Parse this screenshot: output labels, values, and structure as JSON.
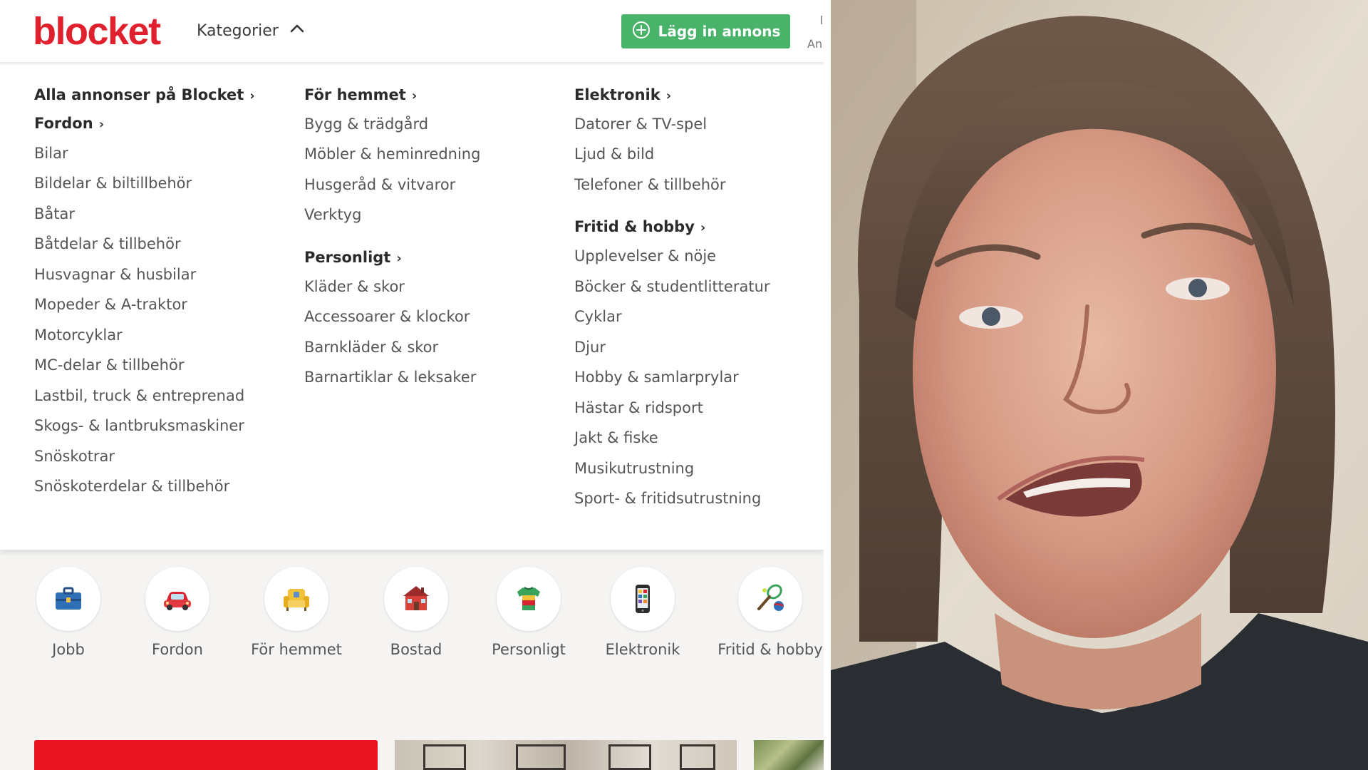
{
  "header": {
    "logo": "blocket",
    "categories_label": "Kategorier",
    "post_ad_label": "Lägg in annons",
    "edge_label": "An"
  },
  "menu": {
    "col1": {
      "heading_all": "Alla annonser på Blocket",
      "heading": "Fordon",
      "items": [
        "Bilar",
        "Bildelar & biltillbehör",
        "Båtar",
        "Båtdelar & tillbehör",
        "Husvagnar & husbilar",
        "Mopeder & A-traktor",
        "Motorcyklar",
        "MC-delar & tillbehör",
        "Lastbil, truck & entreprenad",
        "Skogs- & lantbruksmaskiner",
        "Snöskotrar",
        "Snöskoterdelar & tillbehör"
      ]
    },
    "col2": {
      "heading": "För hemmet",
      "items": [
        "Bygg & trädgård",
        "Möbler & heminredning",
        "Husgeråd & vitvaror",
        "Verktyg"
      ],
      "heading2": "Personligt",
      "items2": [
        "Kläder & skor",
        "Accessoarer & klockor",
        "Barnkläder & skor",
        "Barnartiklar & leksaker"
      ]
    },
    "col3": {
      "heading": "Elektronik",
      "items": [
        "Datorer & TV-spel",
        "Ljud & bild",
        "Telefoner & tillbehör"
      ],
      "heading2": "Fritid & hobby",
      "items2": [
        "Upplevelser & nöje",
        "Böcker & studentlitteratur",
        "Cyklar",
        "Djur",
        "Hobby & samlarprylar",
        "Hästar & ridsport",
        "Jakt & fiske",
        "Musikutrustning",
        "Sport- & fritidsutrustning"
      ]
    }
  },
  "categories": [
    {
      "label": "Jobb",
      "icon": "briefcase-icon"
    },
    {
      "label": "Fordon",
      "icon": "car-icon"
    },
    {
      "label": "För hemmet",
      "icon": "armchair-icon"
    },
    {
      "label": "Bostad",
      "icon": "house-icon"
    },
    {
      "label": "Personligt",
      "icon": "tshirt-icon"
    },
    {
      "label": "Elektronik",
      "icon": "phone-icon"
    },
    {
      "label": "Fritid & hobby",
      "icon": "racket-ball-icon"
    }
  ],
  "colors": {
    "brand_red": "#e0202d",
    "accent_green": "#49b36a",
    "banner_red": "#e8131f"
  }
}
